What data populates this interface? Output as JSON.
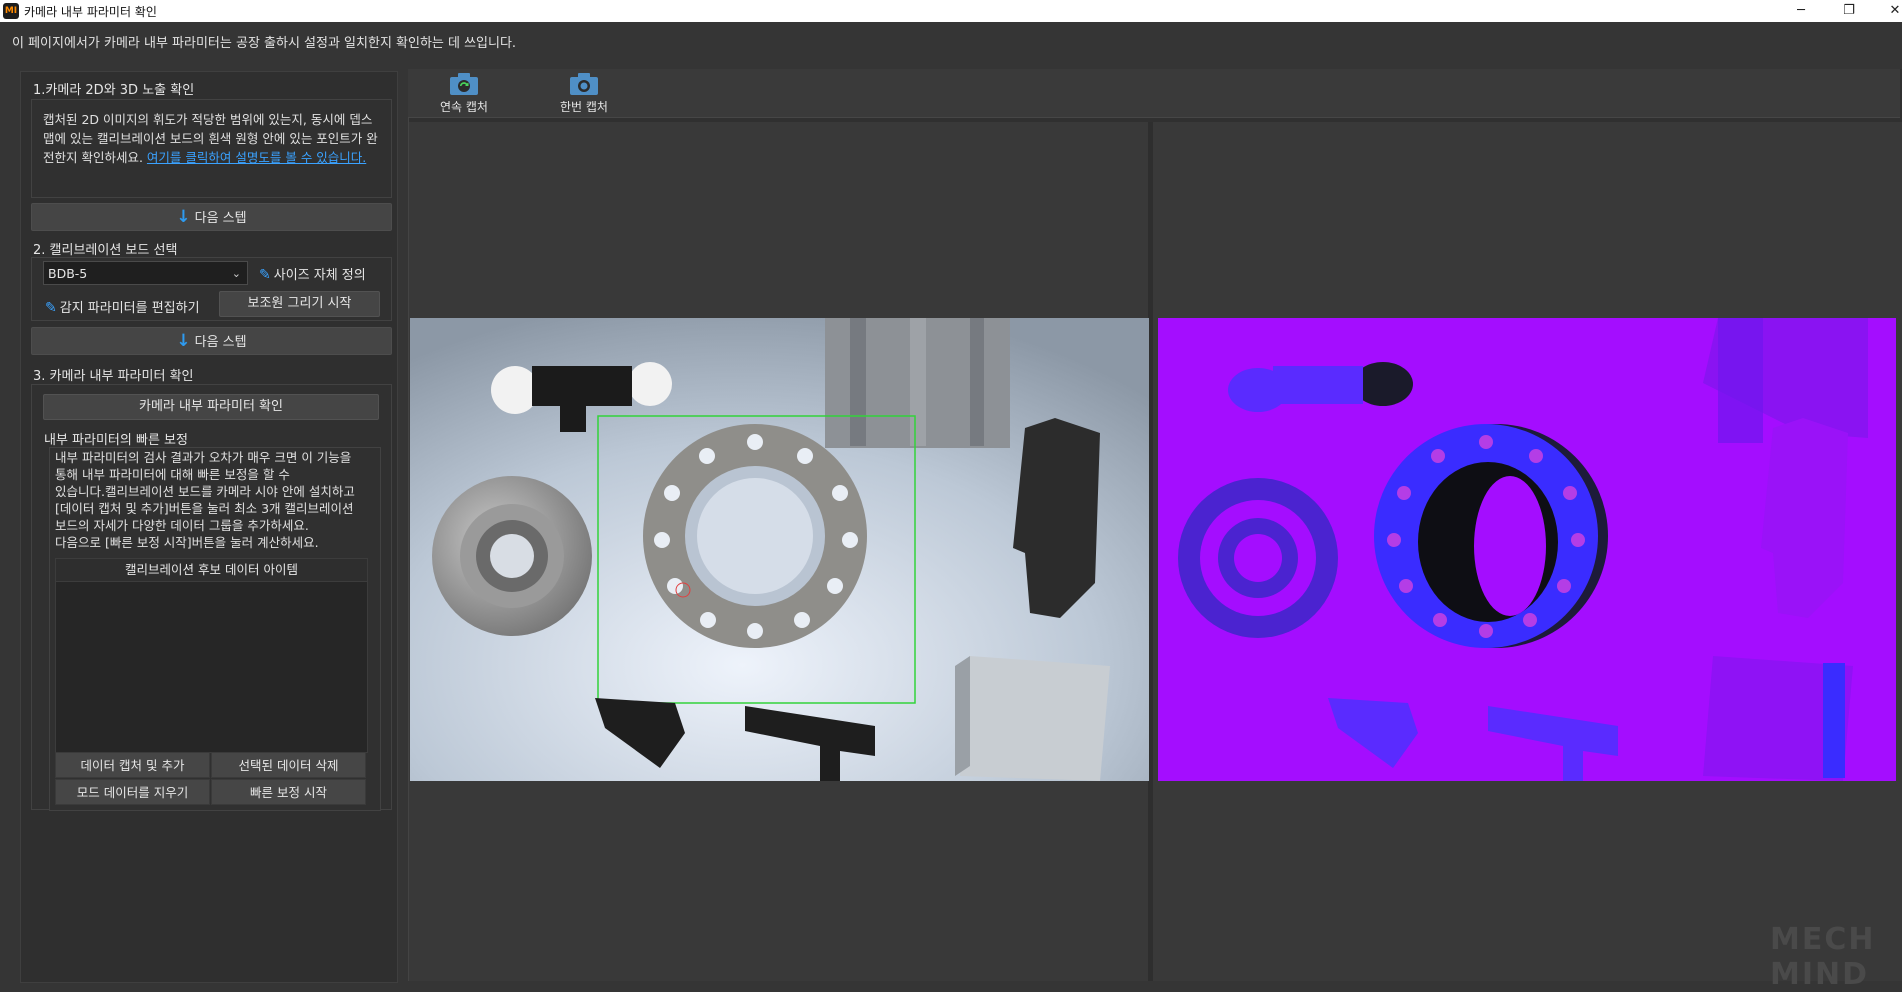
{
  "window": {
    "title": "카메라 내부 파라미터 확인",
    "app_icon_text": "MI",
    "controls": {
      "minimize": "─",
      "maximize": "❐",
      "close": "✕"
    }
  },
  "description": "이 페이지에서가 카메라 내부 파라미터는 공장 출하시 설정과 일치한지 확인하는 데 쓰입니다.",
  "step1": {
    "title": "1.카메라 2D와 3D 노출 확인",
    "text": "캡처된 2D 이미지의 휘도가 적당한 범위에 있는지, 동시에 뎁스 맵에 있는 캘리브레이션 보드의 흰색 원형 안에 있는 포인트가 완전한지 확인하세요. ",
    "link": "여기를 클릭하여 설명도를 볼 수 있습니다."
  },
  "next_step_label": "다음 스텝",
  "step2": {
    "title": "2. 캘리브레이션 보드 선택",
    "board_value": "BDB-5",
    "custom_size": "사이즈 자체 정의",
    "edit_params": "감지 파라미터를 편집하기",
    "start_draw": "보조원 그리기 시작"
  },
  "step3": {
    "title": "3. 카메라 내부 파라미터 확인",
    "check_button": "카메라 내부 파라미터 확인",
    "quick_title": "내부 파라미터의 빠른 보정",
    "quick_text_lines": [
      "내부 파라미터의 검사 결과가 오차가 매우 크면 이 기능을",
      "통해 내부 파라미터에 대해 빠른 보정을 할 수",
      "있습니다.캘리브레이션 보드를 카메라 시야 안에 설치하고",
      "[데이터 캡처 및 추가]버튼을 눌러 최소 3개 캘리브레이션",
      "보드의 자세가 다양한 데이터 그룹을 추가하세요.",
      "다음으로 [빠른 보정 시작]버튼을 눌러 계산하세요."
    ],
    "table_header": "캘리브레이션 후보 데이터 아이템",
    "btn_capture_add": "데이터 캡처 및 추가",
    "btn_delete_selected": "선택된 데이터 삭제",
    "btn_clear_all": "모드 데이터를 지우기",
    "btn_quick_start": "빠른 보정 시작"
  },
  "toolbar": {
    "continuous": "연속 캡처",
    "single": "한번 캡처"
  },
  "watermark": "MECH MIND",
  "colors": {
    "accent": "#2e9bf0",
    "link": "#3aa2ff",
    "depth_bg": "#a40dff",
    "depth_obj": "#5a2bff",
    "roi": "#32d33a"
  },
  "icons": [
    "app-icon",
    "arrow-down-icon",
    "pencil-icon",
    "chevron-down-icon",
    "camera-icon"
  ]
}
